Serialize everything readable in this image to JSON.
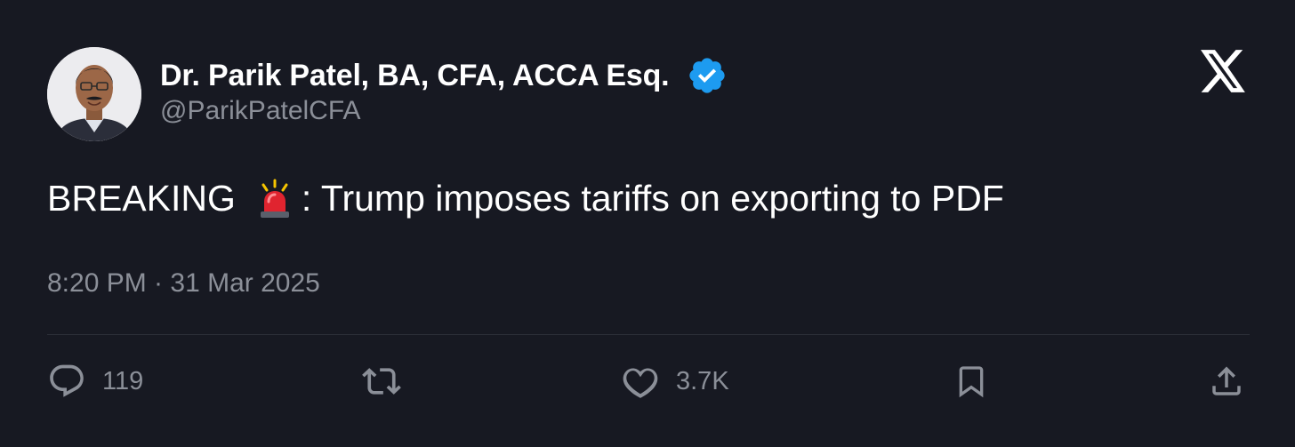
{
  "author": {
    "display_name": "Dr. Parik Patel, BA, CFA, ACCA Esq.",
    "handle": "@ParikPatelCFA",
    "verified": true,
    "verified_color": "#1d9bf0",
    "avatar_icon": "profile-photo"
  },
  "brand": {
    "logo_icon": "x-logo-icon"
  },
  "tweet": {
    "text_before_emoji": "BREAKING",
    "emoji_icon": "police-siren-icon",
    "text_after_emoji": ": Trump imposes tariffs on exporting to PDF",
    "timestamp": "8:20 PM · 31 Mar 2025"
  },
  "actions": {
    "reply": {
      "icon": "reply-icon",
      "count": "119"
    },
    "retweet": {
      "icon": "retweet-icon",
      "count": ""
    },
    "like": {
      "icon": "heart-icon",
      "count": "3.7K"
    },
    "bookmark": {
      "icon": "bookmark-icon",
      "count": ""
    },
    "share": {
      "icon": "share-icon",
      "count": ""
    }
  },
  "colors": {
    "background": "#171922",
    "primary_text": "#ffffff",
    "secondary_text": "#8b8f98",
    "divider": "#2c2f38"
  }
}
